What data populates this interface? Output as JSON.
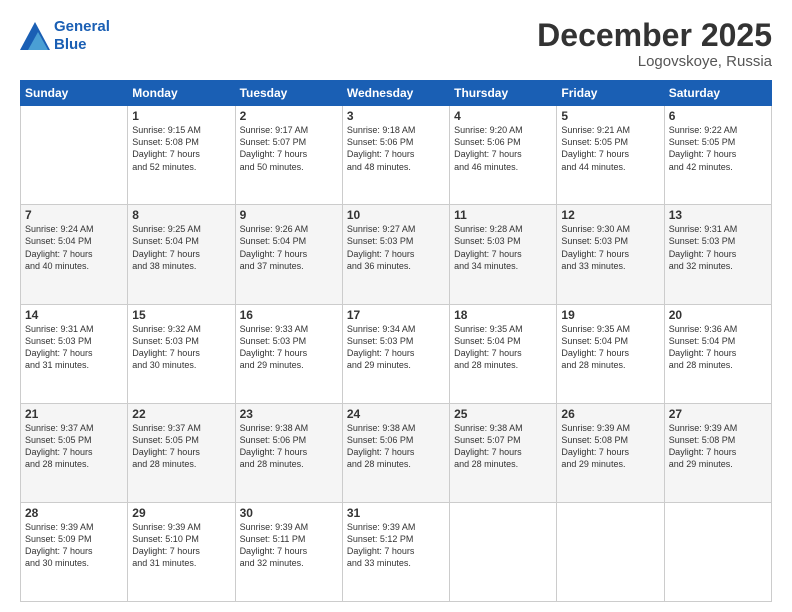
{
  "header": {
    "logo_line1": "General",
    "logo_line2": "Blue",
    "month": "December 2025",
    "location": "Logovskoye, Russia"
  },
  "weekdays": [
    "Sunday",
    "Monday",
    "Tuesday",
    "Wednesday",
    "Thursday",
    "Friday",
    "Saturday"
  ],
  "weeks": [
    [
      {
        "day": "",
        "info": ""
      },
      {
        "day": "1",
        "info": "Sunrise: 9:15 AM\nSunset: 5:08 PM\nDaylight: 7 hours\nand 52 minutes."
      },
      {
        "day": "2",
        "info": "Sunrise: 9:17 AM\nSunset: 5:07 PM\nDaylight: 7 hours\nand 50 minutes."
      },
      {
        "day": "3",
        "info": "Sunrise: 9:18 AM\nSunset: 5:06 PM\nDaylight: 7 hours\nand 48 minutes."
      },
      {
        "day": "4",
        "info": "Sunrise: 9:20 AM\nSunset: 5:06 PM\nDaylight: 7 hours\nand 46 minutes."
      },
      {
        "day": "5",
        "info": "Sunrise: 9:21 AM\nSunset: 5:05 PM\nDaylight: 7 hours\nand 44 minutes."
      },
      {
        "day": "6",
        "info": "Sunrise: 9:22 AM\nSunset: 5:05 PM\nDaylight: 7 hours\nand 42 minutes."
      }
    ],
    [
      {
        "day": "7",
        "info": "Sunrise: 9:24 AM\nSunset: 5:04 PM\nDaylight: 7 hours\nand 40 minutes."
      },
      {
        "day": "8",
        "info": "Sunrise: 9:25 AM\nSunset: 5:04 PM\nDaylight: 7 hours\nand 38 minutes."
      },
      {
        "day": "9",
        "info": "Sunrise: 9:26 AM\nSunset: 5:04 PM\nDaylight: 7 hours\nand 37 minutes."
      },
      {
        "day": "10",
        "info": "Sunrise: 9:27 AM\nSunset: 5:03 PM\nDaylight: 7 hours\nand 36 minutes."
      },
      {
        "day": "11",
        "info": "Sunrise: 9:28 AM\nSunset: 5:03 PM\nDaylight: 7 hours\nand 34 minutes."
      },
      {
        "day": "12",
        "info": "Sunrise: 9:30 AM\nSunset: 5:03 PM\nDaylight: 7 hours\nand 33 minutes."
      },
      {
        "day": "13",
        "info": "Sunrise: 9:31 AM\nSunset: 5:03 PM\nDaylight: 7 hours\nand 32 minutes."
      }
    ],
    [
      {
        "day": "14",
        "info": "Sunrise: 9:31 AM\nSunset: 5:03 PM\nDaylight: 7 hours\nand 31 minutes."
      },
      {
        "day": "15",
        "info": "Sunrise: 9:32 AM\nSunset: 5:03 PM\nDaylight: 7 hours\nand 30 minutes."
      },
      {
        "day": "16",
        "info": "Sunrise: 9:33 AM\nSunset: 5:03 PM\nDaylight: 7 hours\nand 29 minutes."
      },
      {
        "day": "17",
        "info": "Sunrise: 9:34 AM\nSunset: 5:03 PM\nDaylight: 7 hours\nand 29 minutes."
      },
      {
        "day": "18",
        "info": "Sunrise: 9:35 AM\nSunset: 5:04 PM\nDaylight: 7 hours\nand 28 minutes."
      },
      {
        "day": "19",
        "info": "Sunrise: 9:35 AM\nSunset: 5:04 PM\nDaylight: 7 hours\nand 28 minutes."
      },
      {
        "day": "20",
        "info": "Sunrise: 9:36 AM\nSunset: 5:04 PM\nDaylight: 7 hours\nand 28 minutes."
      }
    ],
    [
      {
        "day": "21",
        "info": "Sunrise: 9:37 AM\nSunset: 5:05 PM\nDaylight: 7 hours\nand 28 minutes."
      },
      {
        "day": "22",
        "info": "Sunrise: 9:37 AM\nSunset: 5:05 PM\nDaylight: 7 hours\nand 28 minutes."
      },
      {
        "day": "23",
        "info": "Sunrise: 9:38 AM\nSunset: 5:06 PM\nDaylight: 7 hours\nand 28 minutes."
      },
      {
        "day": "24",
        "info": "Sunrise: 9:38 AM\nSunset: 5:06 PM\nDaylight: 7 hours\nand 28 minutes."
      },
      {
        "day": "25",
        "info": "Sunrise: 9:38 AM\nSunset: 5:07 PM\nDaylight: 7 hours\nand 28 minutes."
      },
      {
        "day": "26",
        "info": "Sunrise: 9:39 AM\nSunset: 5:08 PM\nDaylight: 7 hours\nand 29 minutes."
      },
      {
        "day": "27",
        "info": "Sunrise: 9:39 AM\nSunset: 5:08 PM\nDaylight: 7 hours\nand 29 minutes."
      }
    ],
    [
      {
        "day": "28",
        "info": "Sunrise: 9:39 AM\nSunset: 5:09 PM\nDaylight: 7 hours\nand 30 minutes."
      },
      {
        "day": "29",
        "info": "Sunrise: 9:39 AM\nSunset: 5:10 PM\nDaylight: 7 hours\nand 31 minutes."
      },
      {
        "day": "30",
        "info": "Sunrise: 9:39 AM\nSunset: 5:11 PM\nDaylight: 7 hours\nand 32 minutes."
      },
      {
        "day": "31",
        "info": "Sunrise: 9:39 AM\nSunset: 5:12 PM\nDaylight: 7 hours\nand 33 minutes."
      },
      {
        "day": "",
        "info": ""
      },
      {
        "day": "",
        "info": ""
      },
      {
        "day": "",
        "info": ""
      }
    ]
  ]
}
